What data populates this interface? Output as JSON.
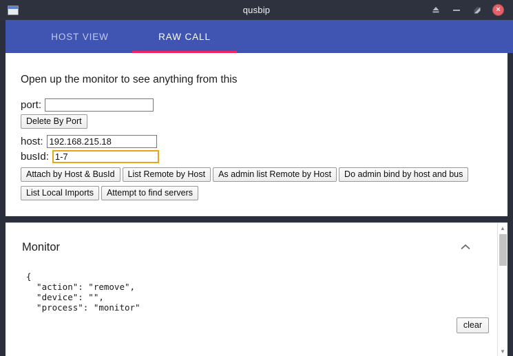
{
  "window": {
    "title": "qusbip",
    "icon": "window-icon",
    "controls": [
      {
        "name": "shade-icon",
        "glyph": "eject"
      },
      {
        "name": "minimize-icon",
        "glyph": "minimize"
      },
      {
        "name": "maximize-icon",
        "glyph": "maximize"
      },
      {
        "name": "close-icon",
        "glyph": "×"
      }
    ],
    "accent_titlebar": "#2e323e"
  },
  "tabs": {
    "accent": "#4054b2",
    "indicator": "#f4245e",
    "items": [
      {
        "label": "HOST VIEW",
        "active": false
      },
      {
        "label": "RAW CALL",
        "active": true
      }
    ]
  },
  "main": {
    "intro": "Open up the monitor to see anything from this",
    "fields": [
      {
        "label": "port:",
        "value": "",
        "placeholder": "",
        "focused": false
      },
      {
        "label": "host:",
        "value": "192.168.215.18",
        "placeholder": "",
        "focused": false
      },
      {
        "label": "busId:",
        "value": "1-7",
        "placeholder": "",
        "focused": true
      }
    ],
    "delete_button": "Delete By Port",
    "action_row_1": [
      "Attach by Host & BusId",
      "List Remote by Host",
      "As admin list Remote by Host",
      "Do admin bind by host and bus"
    ],
    "action_row_2": [
      "List Local Imports",
      "Attempt to find servers"
    ],
    "focus_color": "#e8a317"
  },
  "monitor": {
    "title": "Monitor",
    "collapse_icon": "chevron-up-icon",
    "clear_label": "clear",
    "log": "{\n  \"action\": \"remove\",\n  \"device\": \"\",\n  \"process\": \"monitor\""
  }
}
